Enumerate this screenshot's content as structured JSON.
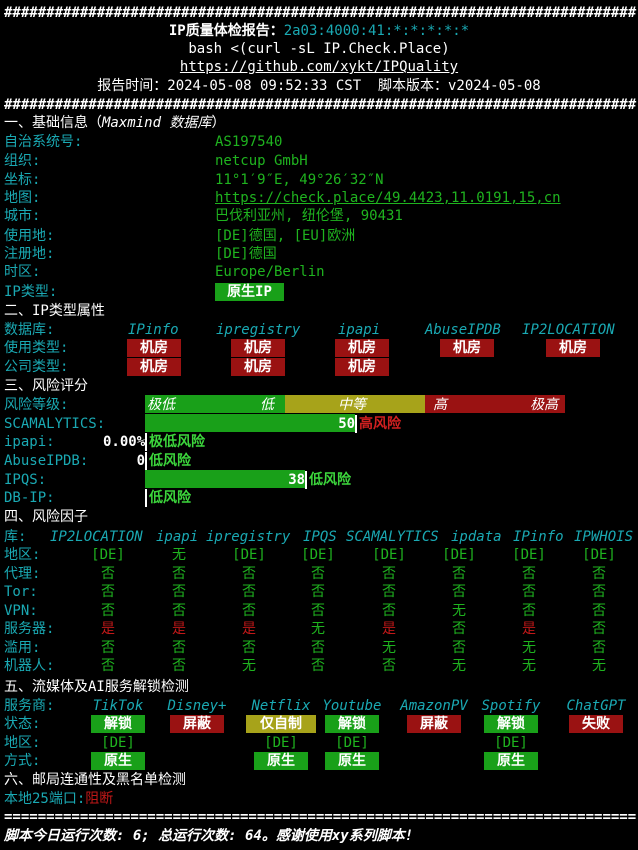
{
  "border": "###########################################################################",
  "border2": "===========================================================================",
  "header": {
    "title_label": "IP质量体检报告：",
    "ip": "2a03:4000:41:*:*:*:*:*",
    "cmd": "bash <(curl -sL IP.Check.Place)",
    "url": "https://github.com/xykt/IPQuality",
    "time_label": "报告时间：",
    "time": "2024-05-08 09:52:33 CST",
    "ver_label": "脚本版本：",
    "ver": "v2024-05-08"
  },
  "s1": {
    "title": "一、基础信息（",
    "title_it": "Maxmind 数据库",
    "title_end": "）",
    "rows": [
      {
        "k": "自治系统号:",
        "v": "AS197540"
      },
      {
        "k": "组织:",
        "v": "netcup GmbH"
      },
      {
        "k": "坐标:",
        "v": "11°1′9″E, 49°26′32″N"
      },
      {
        "k": "地图:",
        "v": "https://check.place/49.4423,11.0191,15,cn"
      },
      {
        "k": "城市:",
        "v": "巴伐利亚州, 纽伦堡, 90431"
      },
      {
        "k": "使用地:",
        "v": "[DE]德国, [EU]欧洲"
      },
      {
        "k": "注册地:",
        "v": "[DE]德国"
      },
      {
        "k": "时区:",
        "v": "Europe/Berlin"
      },
      {
        "k": "IP类型:",
        "v": "原生IP"
      }
    ]
  },
  "s2": {
    "title": "二、IP类型属性",
    "db_label": "数据库:",
    "dbs": [
      "IPinfo",
      "ipregistry",
      "ipapi",
      "AbuseIPDB",
      "IP2LOCATION"
    ],
    "use_label": "使用类型:",
    "use": [
      "机房",
      "机房",
      "机房",
      "机房",
      "机房"
    ],
    "co_label": "公司类型:",
    "co": [
      "机房",
      "机房",
      "机房"
    ]
  },
  "s3": {
    "title": "三、风险评分",
    "level_label": "风险等级:",
    "levels": [
      "极低",
      "低",
      "中等",
      "高",
      "极高"
    ],
    "rows": [
      {
        "k": "SCAMALYTICS:",
        "score": "50",
        "label": "高风险",
        "pct": 0.5
      },
      {
        "k": "ipapi:",
        "score": "0.00%",
        "label": "极低风险",
        "pct": 0
      },
      {
        "k": "AbuseIPDB:",
        "score": "0",
        "label": "低风险",
        "pct": 0
      },
      {
        "k": "IPQS:",
        "score": "38",
        "label": "低风险",
        "pct": 0.38
      },
      {
        "k": "DB-IP:",
        "score": "",
        "label": "低风险",
        "pct": 0
      }
    ]
  },
  "s4": {
    "title": "四、风险因子",
    "lib_label": "库:",
    "libs": [
      "IP2LOCATION",
      "ipapi",
      "ipregistry",
      "IPQS",
      "SCAMALYTICS",
      "ipdata",
      "IPinfo",
      "IPWHOIS"
    ],
    "rows": [
      {
        "k": "地区:",
        "v": [
          "[DE]",
          "无",
          "[DE]",
          "[DE]",
          "[DE]",
          "[DE]",
          "[DE]",
          "[DE]"
        ]
      },
      {
        "k": "代理:",
        "v": [
          "否",
          "否",
          "否",
          "否",
          "否",
          "否",
          "否",
          "否"
        ]
      },
      {
        "k": "Tor:",
        "v": [
          "否",
          "否",
          "否",
          "否",
          "否",
          "否",
          "否",
          "否"
        ]
      },
      {
        "k": "VPN:",
        "v": [
          "否",
          "否",
          "否",
          "否",
          "否",
          "无",
          "否",
          "否"
        ]
      },
      {
        "k": "服务器:",
        "v": [
          "是",
          "是",
          "是",
          "无",
          "是",
          "否",
          "是",
          "否"
        ]
      },
      {
        "k": "滥用:",
        "v": [
          "否",
          "否",
          "否",
          "否",
          "无",
          "否",
          "无",
          "否"
        ]
      },
      {
        "k": "机器人:",
        "v": [
          "否",
          "否",
          "无",
          "否",
          "否",
          "无",
          "无",
          "无"
        ]
      }
    ]
  },
  "s5": {
    "title": "五、流媒体及AI服务解锁检测",
    "svc_label": "服务商:",
    "svcs": [
      "TikTok",
      "Disney+",
      "Netflix",
      "Youtube",
      "AmazonPV",
      "Spotify",
      "ChatGPT"
    ],
    "status_label": "状态:",
    "status": [
      "解锁",
      "屏蔽",
      "仅自制",
      "解锁",
      "屏蔽",
      "解锁",
      "失败"
    ],
    "region_label": "地区:",
    "regions": [
      "[DE]",
      "",
      "[DE]",
      "[DE]",
      "",
      "[DE]",
      ""
    ],
    "method_label": "方式:",
    "methods": [
      "原生",
      "",
      "原生",
      "原生",
      "",
      "原生",
      ""
    ]
  },
  "s6": {
    "title": "六、邮局连通性及黑名单检测",
    "port_label": "本地25端口:",
    "port": "阻断"
  },
  "footer": "脚本今日运行次数: 6; 总运行次数: 64。感谢使用xy系列脚本!",
  "colors": {
    "green": "#19a019",
    "red": "#9a1212",
    "yellow": "#a7a31a",
    "cyan": "#1aa9b3"
  }
}
